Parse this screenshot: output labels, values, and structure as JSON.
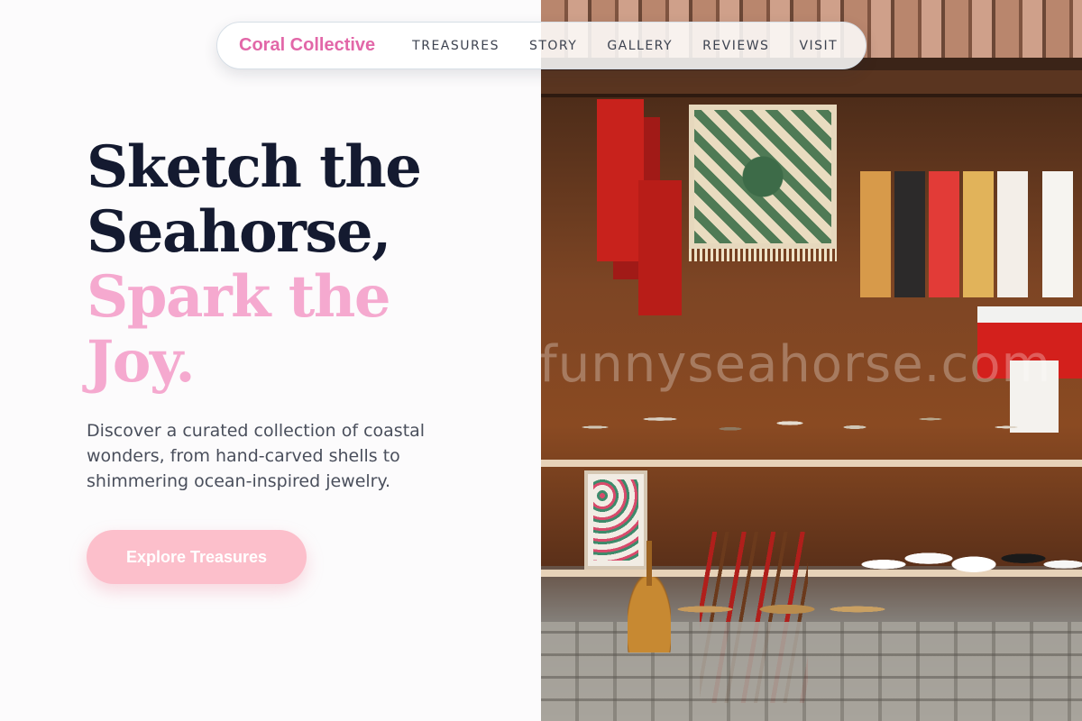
{
  "nav": {
    "brand": "Coral Collective",
    "items": [
      "TREASURES",
      "STORY",
      "GALLERY",
      "REVIEWS",
      "VISIT"
    ]
  },
  "hero": {
    "headline_dark": [
      "Sketch the",
      "Seahorse,"
    ],
    "headline_accent": [
      "Spark the",
      "Joy."
    ],
    "lede": "Discover a curated collection of coastal wonders, from hand-carved shells to shimmering ocean-inspired jewelry.",
    "cta_label": "Explore Treasures"
  },
  "photo": {
    "watermark": "funnyseahorse.com"
  },
  "colors": {
    "brand": "#e267a8",
    "headline_dark": "#141a30",
    "headline_accent": "#f5a9cf",
    "cta_bg": "#fcbfcb",
    "cta_text": "#ffffff"
  }
}
